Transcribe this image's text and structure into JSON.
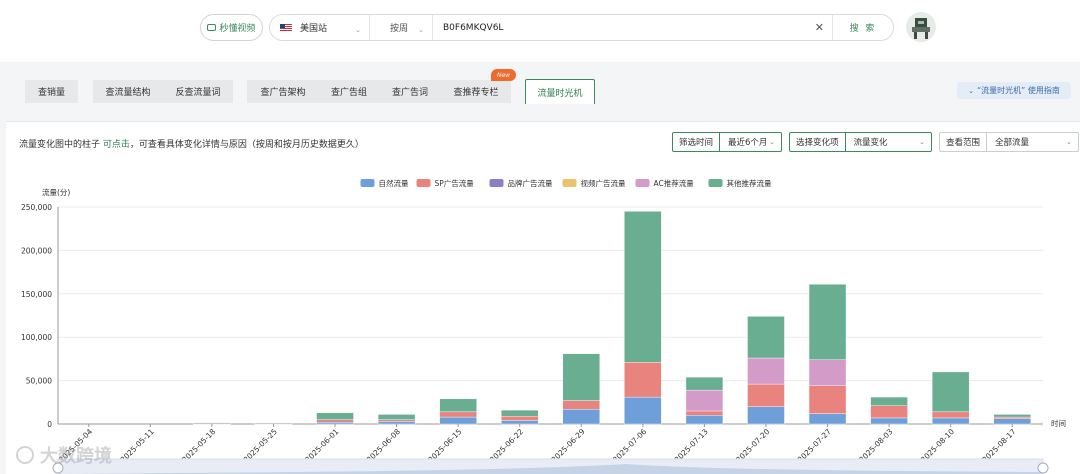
{
  "topbar": {
    "video_label": "秒懂视频",
    "site_label": "美国站",
    "period_label": "按周",
    "query_value": "B0F6MKQV6L",
    "clear_icon": "close-icon",
    "search_label": "搜 索"
  },
  "tabs": [
    {
      "label": "查销量"
    },
    {
      "label": "查流量结构"
    },
    {
      "label": "反查流量词"
    },
    {
      "label": "查广告架构"
    },
    {
      "label": "查广告组"
    },
    {
      "label": "查广告词"
    },
    {
      "label": "查推荐专栏"
    },
    {
      "label": "流量时光机"
    }
  ],
  "new_badge": "New",
  "guide_label": "“流量时光机” 使用指南",
  "panel": {
    "hint_prefix": "流量变化图中的柱子",
    "hint_link": "可点击",
    "hint_suffix": "，可查看具体变化详情与原因（按周和按月历史数据更久）",
    "filter_time_label": "筛选时间",
    "filter_time_value": "最近6个月",
    "change_label": "选择变化项",
    "change_value": "流量变化",
    "scope_label": "查看范围",
    "scope_value": "全部流量"
  },
  "chart_data": {
    "type": "bar",
    "stacked": true,
    "ylabel": "流量(分)",
    "xlabel": "时间",
    "ylim": [
      0,
      250000
    ],
    "yticks": [
      0,
      50000,
      100000,
      150000,
      200000,
      250000
    ],
    "ytick_labels": [
      "0",
      "50,000",
      "100,000",
      "150,000",
      "200,000",
      "250,000"
    ],
    "grid": true,
    "legend_position": "top-center",
    "categories": [
      "2025-05-04",
      "2025-05-11",
      "2025-05-18",
      "2025-05-25",
      "2025-06-01",
      "2025-06-08",
      "2025-06-15",
      "2025-06-22",
      "2025-06-29",
      "2025-07-06",
      "2025-07-13",
      "2025-07-20",
      "2025-07-27",
      "2025-08-03",
      "2025-08-10",
      "2025-08-17"
    ],
    "series": [
      {
        "name": "自然流量",
        "color": "#6f9fd8",
        "values": [
          0,
          0,
          500,
          300,
          2000,
          3000,
          8000,
          4000,
          17000,
          31000,
          10000,
          20000,
          12000,
          7000,
          7000,
          6000
        ]
      },
      {
        "name": "SP广告流量",
        "color": "#e8837e",
        "values": [
          0,
          0,
          300,
          300,
          3000,
          2000,
          6000,
          5000,
          10000,
          40000,
          5000,
          26000,
          32000,
          14000,
          7000,
          2000
        ]
      },
      {
        "name": "品牌广告流量",
        "color": "#8e7fc2",
        "values": [
          0,
          0,
          0,
          0,
          0,
          0,
          0,
          0,
          0,
          0,
          0,
          0,
          0,
          0,
          0,
          0
        ]
      },
      {
        "name": "视频广告流量",
        "color": "#e8c46a",
        "values": [
          0,
          0,
          0,
          0,
          0,
          0,
          0,
          0,
          0,
          0,
          0,
          0,
          0,
          0,
          0,
          0
        ]
      },
      {
        "name": "AC推荐流量",
        "color": "#d39bc8",
        "values": [
          0,
          0,
          0,
          0,
          0,
          0,
          0,
          0,
          0,
          0,
          24000,
          30000,
          30000,
          0,
          0,
          0
        ]
      },
      {
        "name": "其他推荐流量",
        "color": "#6aae92",
        "values": [
          0,
          0,
          700,
          900,
          8000,
          6000,
          15000,
          7000,
          54000,
          174000,
          15000,
          48000,
          87000,
          10000,
          46000,
          3000
        ]
      }
    ]
  },
  "watermark": "大数跨境"
}
